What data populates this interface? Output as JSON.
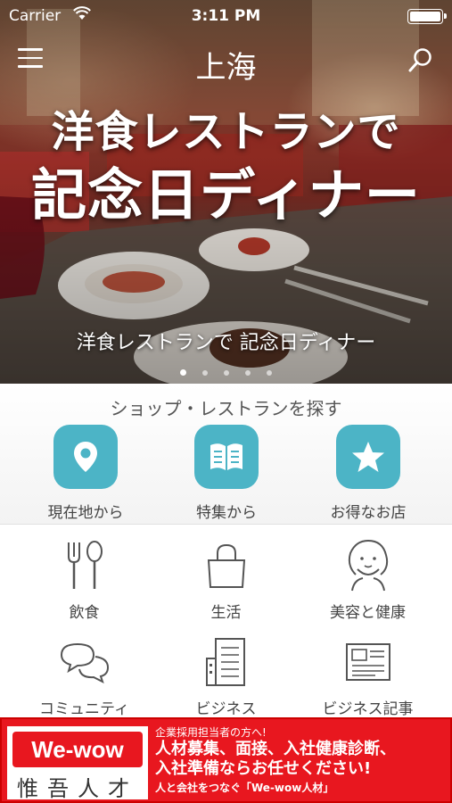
{
  "status_bar": {
    "carrier": "Carrier",
    "time": "3:11 PM"
  },
  "nav": {
    "title": "上海",
    "menu_icon": "hamburger-menu-icon",
    "search_icon": "search-icon"
  },
  "hero": {
    "headline_line1": "洋食レストランで",
    "headline_line2": "記念日ディナー",
    "caption": "洋食レストランで 記念日ディナー",
    "slide_count": 5,
    "active_slide": 1
  },
  "finder": {
    "title": "ショップ・レストランを探す",
    "accent_color": "#4cb4c6",
    "items": [
      {
        "label": "現在地から",
        "icon": "location-pin-icon"
      },
      {
        "label": "特集から",
        "icon": "open-book-icon"
      },
      {
        "label": "お得なお店",
        "icon": "star-icon"
      }
    ]
  },
  "categories": [
    {
      "label": "飲食",
      "icon": "fork-spoon-icon"
    },
    {
      "label": "生活",
      "icon": "shopping-bag-icon"
    },
    {
      "label": "美容と健康",
      "icon": "face-icon"
    },
    {
      "label": "コミュニティ",
      "icon": "speech-bubbles-icon"
    },
    {
      "label": "ビジネス",
      "icon": "office-building-icon"
    },
    {
      "label": "ビジネス記事",
      "icon": "newspaper-icon"
    }
  ],
  "ad": {
    "logo": "We-wow",
    "logo_sub": "惟吾人才",
    "eyebrow": "企業採用担当者の方へ!",
    "line1": "人材募集、面接、入社健康診断、",
    "line2": "入社準備ならお任せください!",
    "footer": "人と会社をつなぐ「We-wow人材」",
    "color": "#e8171f"
  }
}
